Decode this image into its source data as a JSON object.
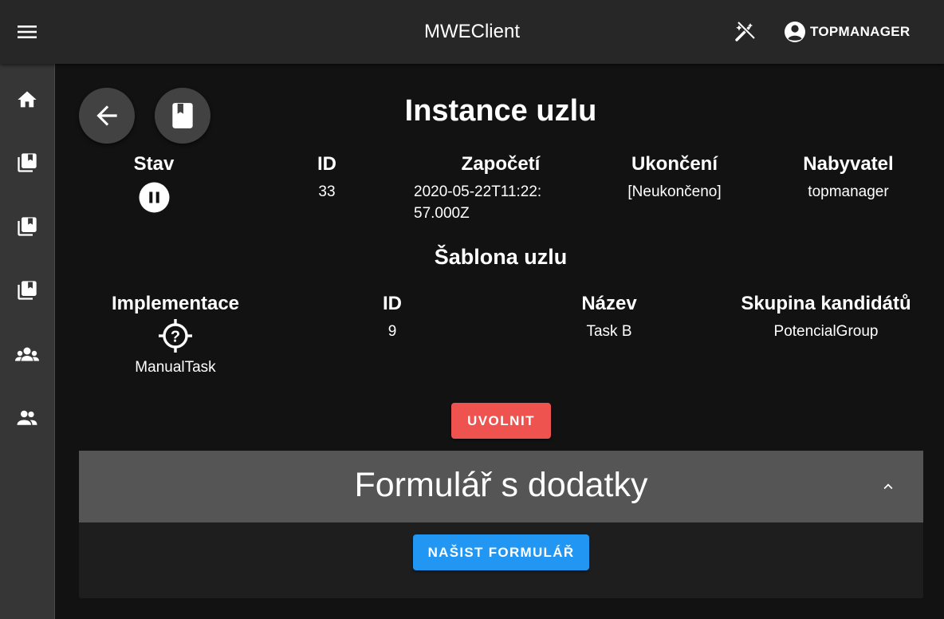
{
  "app": {
    "title": "MWEClient"
  },
  "user": {
    "name": "TOPMANAGER"
  },
  "icons": {
    "menu": "menu-icon",
    "theme": "theme-toggle-icon",
    "account": "account-circle-icon",
    "back": "arrow-left-icon",
    "book": "book-icon",
    "state": "pause-circle-icon",
    "implementation": "help-target-icon",
    "collapse": "chevron-up-icon"
  },
  "sidebar": {
    "items": [
      {
        "icon": "home-icon"
      },
      {
        "icon": "library-books-icon"
      },
      {
        "icon": "library-books-icon"
      },
      {
        "icon": "library-books-icon"
      },
      {
        "icon": "groups-icon"
      },
      {
        "icon": "people-icon"
      }
    ]
  },
  "instance": {
    "title": "Instance uzlu",
    "headers": {
      "state": "Stav",
      "id": "ID",
      "start": "Započetí",
      "end": "Ukončení",
      "assignee": "Nabyvatel"
    },
    "values": {
      "id": "33",
      "start": "2020-05-22T11:22:57.000Z",
      "end": "[Neukončeno]",
      "assignee": "topmanager"
    }
  },
  "template": {
    "title": "Šablona uzlu",
    "headers": {
      "implementation": "Implementace",
      "id": "ID",
      "name": "Název",
      "group": "Skupina kandidátů"
    },
    "values": {
      "implementation": "ManualTask",
      "id": "9",
      "name": "Task B",
      "group": "PotencialGroup"
    }
  },
  "actions": {
    "release_label": "UVOLNIT"
  },
  "form_panel": {
    "title": "Formulář s dodatky",
    "load_label": "NAŠIST FORMULÁŘ"
  },
  "colors": {
    "appbar": "#272727",
    "sidebar": "#363636",
    "background": "#121212",
    "release": "#ef5350",
    "load": "#2196f3",
    "panel_header": "#555555"
  }
}
